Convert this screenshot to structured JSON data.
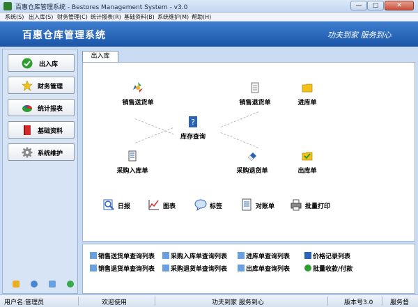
{
  "window": {
    "title": "百惠仓库管理系统 - Bestores Management System - v3.0",
    "minimize": "—",
    "maximize": "□",
    "close": "✕"
  },
  "menu": [
    "系统(S)",
    "出入库(S)",
    "财务管理(C)",
    "统计报表(R)",
    "基础资料(B)",
    "系统维护(M)",
    "帮助(H)"
  ],
  "banner": {
    "title": "百惠仓库管理系统",
    "slogan": "功夫到家 服务到心"
  },
  "sidebar": {
    "items": [
      {
        "label": "出入库",
        "icon": "check-circle-icon",
        "color": "#2e9e2e"
      },
      {
        "label": "财务管理",
        "icon": "star-icon",
        "color": "#f2c21a"
      },
      {
        "label": "统计报表",
        "icon": "pie-chart-icon",
        "color": "#d23030"
      },
      {
        "label": "基础资料",
        "icon": "book-icon",
        "color": "#d22a2a"
      },
      {
        "label": "系统维护",
        "icon": "gear-icon",
        "color": "#777777"
      }
    ],
    "bottom_icons": [
      "lock-icon",
      "clock-icon",
      "search-icon",
      "up-arrow-icon"
    ]
  },
  "tab": {
    "label": "出入库"
  },
  "flow": {
    "sales_delivery": "销售送货单",
    "sales_return": "销售退货单",
    "stock_in": "进库单",
    "inventory_query": "库存查询",
    "purchase_in": "采购入库单",
    "purchase_return": "采购退货单",
    "stock_out": "出库单"
  },
  "tools": [
    "日报",
    "图表",
    "标签",
    "对账单",
    "批量打印"
  ],
  "queries": {
    "row1": [
      "销售送货单查询列表",
      "采购入库单查询列表",
      "进库单查询列表",
      "价格记录列表"
    ],
    "row2": [
      "销售退货单查询列表",
      "采购退货单查询列表",
      "出库单查询列表",
      "批量收款/付款"
    ]
  },
  "status": {
    "user": "用户名:管理员",
    "welcome": "欢迎使用",
    "slogan": "功夫到家 服务到心",
    "version": "版本号3.0",
    "service": "服务督"
  },
  "colors": {
    "banner": "#2a64b8",
    "accent_green": "#2e9e2e",
    "accent_blue": "#2a64b8"
  }
}
